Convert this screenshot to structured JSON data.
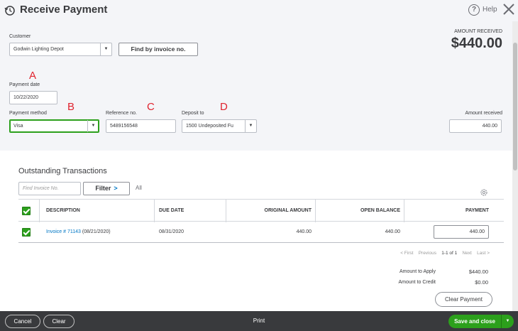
{
  "header": {
    "title": "Receive Payment",
    "help_label": "Help"
  },
  "form": {
    "customer_label": "Customer",
    "customer_value": "Godwin Lighting Depot",
    "find_invoice_label": "Find by invoice no.",
    "amount_received_heading": "AMOUNT RECEIVED",
    "amount_received_total": "$440.00",
    "payment_date_label": "Payment date",
    "payment_date_value": "10/22/2020",
    "payment_method_label": "Payment method",
    "payment_method_value": "Visa",
    "reference_label": "Reference no.",
    "reference_value": "5489156548",
    "deposit_to_label": "Deposit to",
    "deposit_to_value": "1500 Undeposited Fu",
    "amount_received_label": "Amount received",
    "amount_received_value": "440.00"
  },
  "annotations": [
    "A",
    "B",
    "C",
    "D"
  ],
  "outstanding": {
    "title": "Outstanding Transactions",
    "find_placeholder": "Find Invoice No.",
    "filter_label": "Filter",
    "all_label": "All",
    "columns": [
      "DESCRIPTION",
      "DUE DATE",
      "ORIGINAL AMOUNT",
      "OPEN BALANCE",
      "PAYMENT"
    ],
    "rows": [
      {
        "invoice_link": "Invoice # 71143",
        "invoice_date": " (08/21/2020)",
        "due_date": "08/31/2020",
        "original_amount": "440.00",
        "open_balance": "440.00",
        "payment": "440.00"
      }
    ],
    "pager": {
      "first": "< First",
      "previous": "Previous",
      "range": "1-1 of 1",
      "next": "Next",
      "last": "Last >"
    },
    "amount_to_apply_label": "Amount to Apply",
    "amount_to_apply_value": "$440.00",
    "amount_to_credit_label": "Amount to Credit",
    "amount_to_credit_value": "$0.00",
    "clear_payment_label": "Clear Payment"
  },
  "footer": {
    "cancel_label": "Cancel",
    "clear_label": "Clear",
    "print_label": "Print",
    "save_label": "Save and close"
  },
  "colors": {
    "accent_green": "#2ca01c",
    "link_blue": "#0077c5",
    "annotation_red": "#e0232e",
    "footer_bg": "#393a3d"
  }
}
